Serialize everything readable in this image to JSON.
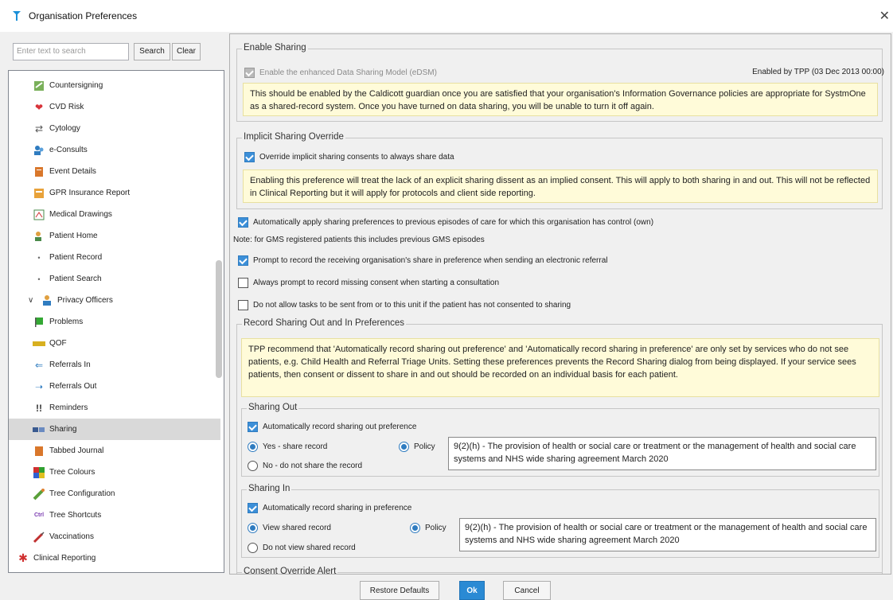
{
  "window": {
    "title": "Organisation Preferences"
  },
  "search": {
    "placeholder": "Enter text to search",
    "search_label": "Search",
    "clear_label": "Clear"
  },
  "tree": {
    "items": [
      {
        "label": "Countersigning",
        "icon": "countersign-icon"
      },
      {
        "label": "CVD Risk",
        "icon": "heart-icon"
      },
      {
        "label": "Cytology",
        "icon": "cytology-icon"
      },
      {
        "label": "e-Consults",
        "icon": "people-icon"
      },
      {
        "label": "Event Details",
        "icon": "event-icon"
      },
      {
        "label": "GPR Insurance Report",
        "icon": "report-icon"
      },
      {
        "label": "Medical Drawings",
        "icon": "drawing-icon"
      },
      {
        "label": "Patient Home",
        "icon": "patient-home-icon"
      },
      {
        "label": "Patient Record",
        "icon": "bullet"
      },
      {
        "label": "Patient Search",
        "icon": "bullet"
      },
      {
        "label": "Privacy Officers",
        "icon": "privacy-icon"
      },
      {
        "label": "Problems",
        "icon": "flag-icon"
      },
      {
        "label": "QOF",
        "icon": "qof-icon"
      },
      {
        "label": "Referrals In",
        "icon": "referral-in-icon"
      },
      {
        "label": "Referrals Out",
        "icon": "referral-out-icon"
      },
      {
        "label": "Reminders",
        "icon": "reminder-icon"
      },
      {
        "label": "Sharing",
        "icon": "sharing-icon"
      },
      {
        "label": "Tabbed Journal",
        "icon": "journal-icon"
      },
      {
        "label": "Tree Colours",
        "icon": "colours-icon"
      },
      {
        "label": "Tree Configuration",
        "icon": "config-icon"
      },
      {
        "label": "Tree Shortcuts",
        "icon": "shortcuts-icon"
      },
      {
        "label": "Vaccinations",
        "icon": "vaccination-icon"
      },
      {
        "label": "Clinical Reporting",
        "icon": "clinical-reporting-icon"
      }
    ]
  },
  "enable_sharing": {
    "legend": "Enable Sharing",
    "checkbox_label": "Enable the enhanced Data Sharing Model (eDSM)",
    "enabled_by": "Enabled by TPP (03 Dec 2013 00:00)",
    "note": "This should be enabled by the Caldicott guardian once you are satisfied that your organisation's Information Governance policies are appropriate for SystmOne as a shared-record system. Once you have turned on data sharing, you will be unable to turn it off again."
  },
  "implicit": {
    "legend": "Implicit Sharing Override",
    "checkbox_label": "Override implicit sharing consents to always share data",
    "note": "Enabling this preference will treat the lack of an explicit sharing dissent as an implied consent. This will apply to both sharing in and out. This will not be reflected in Clinical Reporting but it will apply for protocols and client side reporting."
  },
  "options": {
    "auto_apply": "Automatically apply sharing preferences to previous episodes of care for which this organisation has control (own)",
    "gms_note": "Note: for GMS registered patients this includes previous GMS episodes",
    "prompt_receiving": "Prompt to record the receiving organisation's share in preference when sending an electronic referral",
    "prompt_missing": "Always prompt to record missing consent when starting a consultation",
    "no_tasks": "Do not allow tasks to be sent from or to this unit if the patient has not consented to sharing"
  },
  "record_sharing": {
    "legend": "Record Sharing Out and In Preferences",
    "note": "TPP recommend that 'Automatically record sharing out preference' and 'Automatically record sharing in preference' are only set by services who do not see patients, e.g. Child Health and Referral Triage Units. Setting these preferences prevents the Record Sharing dialog from being displayed. If your service sees patients, then consent or dissent to share in and out should be recorded on an individual basis for each patient.",
    "out": {
      "legend": "Sharing Out",
      "checkbox_label": "Automatically record sharing out preference",
      "yes_label": "Yes - share record",
      "no_label": "No - do not share the record",
      "policy_label": "Policy",
      "policy_text": "9(2)(h) - The provision of health or social care or treatment or the management of health and social care systems and NHS wide sharing agreement March 2020"
    },
    "in": {
      "legend": "Sharing In",
      "checkbox_label": "Automatically record sharing in preference",
      "view_label": "View shared record",
      "noview_label": "Do not view shared record",
      "policy_label": "Policy",
      "policy_text": "9(2)(h) - The provision of health or social care or treatment or the management of health and social care systems and NHS wide sharing agreement March 2020"
    },
    "next_legend": "Consent Override Alert"
  },
  "footer": {
    "restore_label": "Restore Defaults",
    "ok_label": "Ok",
    "cancel_label": "Cancel"
  },
  "colors": {
    "accent": "#2a8ad4",
    "note_bg": "#fffbd9",
    "selected_bg": "#d9d9d9"
  }
}
